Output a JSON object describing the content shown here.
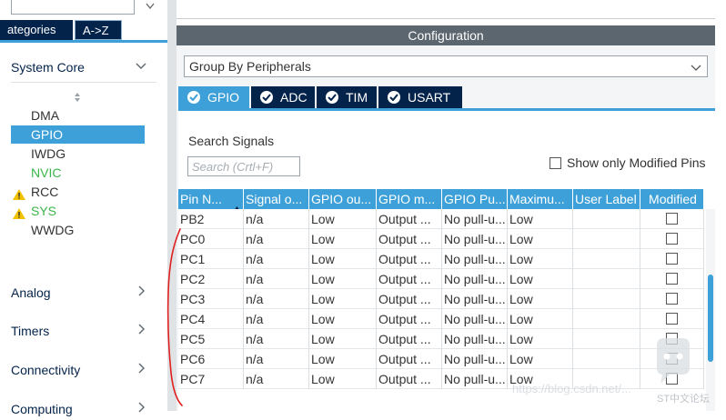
{
  "left_panel": {
    "category_tabs": [
      {
        "label": "ategories"
      },
      {
        "label": "A->Z"
      }
    ],
    "system_core": {
      "label": "System Core",
      "items": [
        {
          "label": "DMA",
          "state": "normal"
        },
        {
          "label": "GPIO",
          "state": "selected"
        },
        {
          "label": "IWDG",
          "state": "normal"
        },
        {
          "label": "NVIC",
          "state": "configured"
        },
        {
          "label": "RCC",
          "state": "warning"
        },
        {
          "label": "SYS",
          "state": "warning-configured"
        },
        {
          "label": "WWDG",
          "state": "normal"
        }
      ]
    },
    "categories": [
      {
        "label": "Analog"
      },
      {
        "label": "Timers"
      },
      {
        "label": "Connectivity"
      },
      {
        "label": "Computing"
      }
    ]
  },
  "configuration": {
    "title": "Configuration",
    "group_select": {
      "value": "Group By Peripherals"
    },
    "mode_tabs": [
      {
        "label": "GPIO",
        "active": true
      },
      {
        "label": "ADC",
        "active": false
      },
      {
        "label": "TIM",
        "active": false
      },
      {
        "label": "USART",
        "active": false
      }
    ],
    "search": {
      "label": "Search Signals",
      "placeholder": "Search (Crtl+F)"
    },
    "show_modified": {
      "label": "Show only Modified Pins",
      "checked": false
    }
  },
  "pin_table": {
    "columns": [
      "Pin N...",
      "Signal o...",
      "GPIO ou...",
      "GPIO m...",
      "GPIO Pu...",
      "Maximu...",
      "User Label",
      "Modified"
    ],
    "rows": [
      {
        "pin": "PB2",
        "signal": "n/a",
        "gpio_output": "Low",
        "gpio_mode": "Output ...",
        "gpio_pull": "No pull-u...",
        "max_speed": "Low",
        "user_label": "",
        "modified": false
      },
      {
        "pin": "PC0",
        "signal": "n/a",
        "gpio_output": "Low",
        "gpio_mode": "Output ...",
        "gpio_pull": "No pull-u...",
        "max_speed": "Low",
        "user_label": "",
        "modified": false
      },
      {
        "pin": "PC1",
        "signal": "n/a",
        "gpio_output": "Low",
        "gpio_mode": "Output ...",
        "gpio_pull": "No pull-u...",
        "max_speed": "Low",
        "user_label": "",
        "modified": false
      },
      {
        "pin": "PC2",
        "signal": "n/a",
        "gpio_output": "Low",
        "gpio_mode": "Output ...",
        "gpio_pull": "No pull-u...",
        "max_speed": "Low",
        "user_label": "",
        "modified": false
      },
      {
        "pin": "PC3",
        "signal": "n/a",
        "gpio_output": "Low",
        "gpio_mode": "Output ...",
        "gpio_pull": "No pull-u...",
        "max_speed": "Low",
        "user_label": "",
        "modified": false
      },
      {
        "pin": "PC4",
        "signal": "n/a",
        "gpio_output": "Low",
        "gpio_mode": "Output ...",
        "gpio_pull": "No pull-u...",
        "max_speed": "Low",
        "user_label": "",
        "modified": false
      },
      {
        "pin": "PC5",
        "signal": "n/a",
        "gpio_output": "Low",
        "gpio_mode": "Output ...",
        "gpio_pull": "No pull-u...",
        "max_speed": "Low",
        "user_label": "",
        "modified": false
      },
      {
        "pin": "PC6",
        "signal": "n/a",
        "gpio_output": "Low",
        "gpio_mode": "Output ...",
        "gpio_pull": "No pull-u...",
        "max_speed": "Low",
        "user_label": "",
        "modified": false
      },
      {
        "pin": "PC7",
        "signal": "n/a",
        "gpio_output": "Low",
        "gpio_mode": "Output ...",
        "gpio_pull": "No pull-u...",
        "max_speed": "Low",
        "user_label": "",
        "modified": false
      }
    ]
  },
  "watermark": {
    "text": "https://blog.csdn.net/...",
    "brand": "ST中文论坛"
  },
  "colors": {
    "accent": "#3ea0d8",
    "navy": "#03234b",
    "config_bar": "#5c666f",
    "configured_green": "#3bb54a",
    "warning_yellow": "#f2c200",
    "annotation_red": "#e02020"
  },
  "icons": {
    "accordion_expanded": "chevron-down-icon",
    "accordion_collapsed": "chevron-right-icon",
    "sort": "sort-arrows-icon",
    "warning": "warning-triangle-icon",
    "tab_check": "check-circle-icon",
    "select_arrow": "chevron-down-icon"
  }
}
